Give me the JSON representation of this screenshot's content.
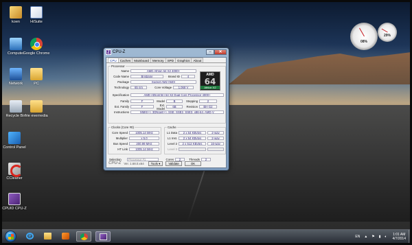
{
  "desktop": {
    "icons": [
      {
        "label": "koen",
        "icon": "user-folder-icon"
      },
      {
        "label": "HiSuite",
        "icon": "hisuite-icon"
      },
      {
        "label": "Computer",
        "icon": "computer-icon"
      },
      {
        "label": "Google Chrome",
        "icon": "chrome-icon"
      },
      {
        "label": "Network",
        "icon": "network-icon"
      },
      {
        "label": "PC",
        "icon": "folder-icon"
      },
      {
        "label": "Recycle Bin",
        "icon": "recycle-bin-icon"
      },
      {
        "label": "frie evernedia",
        "icon": "folder-icon"
      },
      {
        "label": "Control Panel",
        "icon": "control-panel-icon"
      },
      {
        "label": "CCleaner",
        "icon": "ccleaner-icon"
      },
      {
        "label": "CPUID CPU-Z",
        "icon": "cpuz-icon"
      }
    ]
  },
  "gadget": {
    "cpu_percent": "08%",
    "memory_percent": "29%"
  },
  "cpuz": {
    "title": "CPU-Z",
    "tabs": [
      "CPU",
      "Caches",
      "Mainboard",
      "Memory",
      "SPD",
      "Graphics",
      "About"
    ],
    "processor": {
      "group_label": "Processor",
      "name_label": "Name",
      "name": "AMD Athlon 64 X2 4000+",
      "code_name_label": "Code Name",
      "code_name": "Brisbane",
      "brand_id_label": "Brand ID",
      "brand_id": "4",
      "package_label": "Package",
      "package": "Socket AM2 (940)",
      "technology_label": "Technology",
      "technology": "65 nm",
      "core_voltage_label": "Core Voltage",
      "core_voltage": "1.068 V",
      "specification_label": "Specification",
      "specification": "AMD Athlon(tm) 64 X2 Dual Core Processor 4000+",
      "family_label": "Family",
      "family": "F",
      "model_label": "Model",
      "model": "B",
      "stepping_label": "Stepping",
      "stepping": "2",
      "ext_family_label": "Ext. Family",
      "ext_family": "F",
      "ext_model_label": "Ext. Model",
      "ext_model": "6B",
      "revision_label": "Revision",
      "revision": "BH-G2",
      "instructions_label": "Instructions",
      "instructions": "MMX(+), 3DNow!(+), SSE, SSE2, SSE3, x86-64, AMD-V",
      "logo_brand": "AMD",
      "logo_number": "64",
      "logo_sub": "Athlon X2"
    },
    "clocks": {
      "group_label": "Clocks (Core #0)",
      "core_speed_label": "Core Speed",
      "core_speed": "1005.14 MHz",
      "multiplier_label": "Multiplier",
      "multiplier": "x 5.0",
      "bus_speed_label": "Bus Speed",
      "bus_speed": "200.99 MHz",
      "ht_link_label": "HT Link",
      "ht_link": "1005.14 MHz"
    },
    "cache": {
      "group_label": "Cache",
      "l1_data_label": "L1 Data",
      "l1_data": "2 x 64 KBytes",
      "l1_data_way": "2-way",
      "l1_inst_label": "L1 Inst.",
      "l1_inst": "2 x 64 KBytes",
      "l1_inst_way": "2-way",
      "level2_label": "Level 2",
      "level2": "2 x 512 KBytes",
      "level2_way": "16-way",
      "level3_label": "Level 3"
    },
    "selection": {
      "label": "Selection",
      "value": "Processor #1",
      "cores_label": "Cores",
      "cores": "2",
      "threads_label": "Threads",
      "threads": "2"
    },
    "footer": {
      "brand": "CPU-Z",
      "version": "Ver. 1.68.0.x64",
      "tools_label": "Tools",
      "validate_label": "Validate",
      "ok_label": "OK"
    }
  },
  "taskbar": {
    "language": "EN",
    "time": "1:01 AM",
    "date": "4/7/2014"
  }
}
